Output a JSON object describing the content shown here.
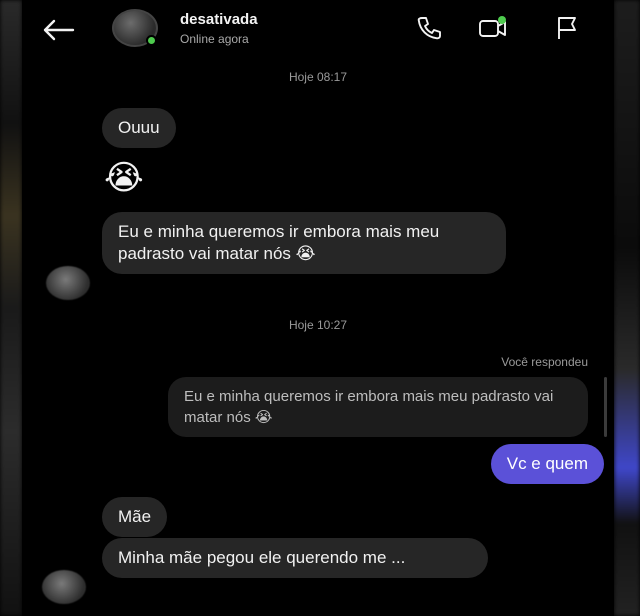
{
  "header": {
    "contact_name": "desativada",
    "status": "Online agora"
  },
  "icons": {
    "back": "back-arrow-icon",
    "call": "phone-icon",
    "video": "video-icon",
    "report": "flag-icon"
  },
  "colors": {
    "background": "#000000",
    "incoming_bubble": "#262626",
    "outgoing_bubble": "#5b51d8",
    "online": "#4ecb4e"
  },
  "messages": {
    "time_1": "Hoje 08:17",
    "msg_1": "Ouuu",
    "msg_2_emoji": "😭",
    "msg_3": "Eu e minha queremos ir embora mais meu padrasto vai matar nós",
    "msg_3_emoji": "😭",
    "time_2": "Hoje 10:27",
    "reply_label": "Você respondeu",
    "quoted": "Eu e minha queremos ir embora mais meu padrasto vai matar nós",
    "quoted_emoji": "😭",
    "msg_4": "Vc e quem",
    "msg_5": "Mãe",
    "msg_6": "Minha mãe pegou ele querendo me ..."
  }
}
